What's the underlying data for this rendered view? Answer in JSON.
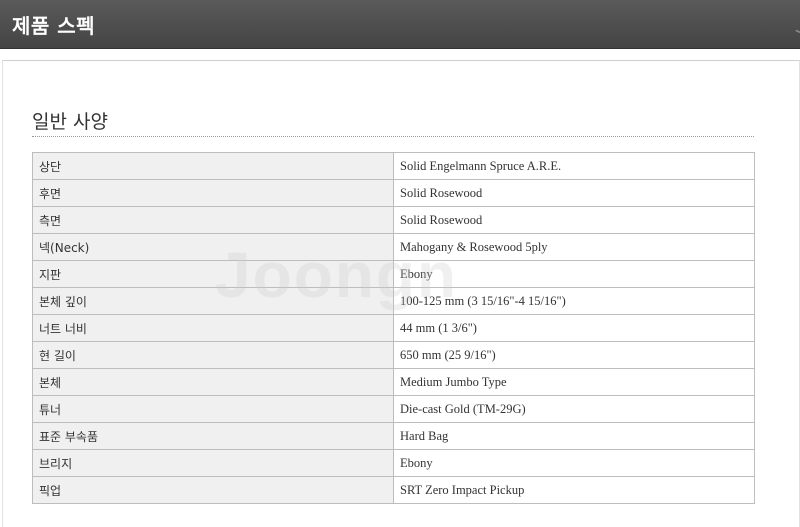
{
  "header": {
    "title": "제품 스펙",
    "corner_watermark": "larr"
  },
  "section": {
    "title": "일반 사양"
  },
  "watermark": "Joongn",
  "specs": [
    {
      "label": "상단",
      "value": "Solid Engelmann Spruce A.R.E."
    },
    {
      "label": "후면",
      "value": "Solid Rosewood"
    },
    {
      "label": "측면",
      "value": "Solid Rosewood"
    },
    {
      "label": "넥(Neck)",
      "value": "Mahogany & Rosewood 5ply"
    },
    {
      "label": "지판",
      "value": "Ebony"
    },
    {
      "label": "본체 깊이",
      "value": "100-125 mm (3 15/16\"-4 15/16\")"
    },
    {
      "label": "너트 너비",
      "value": "44 mm (1 3/6\")"
    },
    {
      "label": "현 길이",
      "value": "650 mm (25 9/16\")"
    },
    {
      "label": "본체",
      "value": "Medium Jumbo Type"
    },
    {
      "label": "튜너",
      "value": "Die-cast Gold (TM-29G)"
    },
    {
      "label": "표준 부속품",
      "value": "Hard Bag"
    },
    {
      "label": "브리지",
      "value": "Ebony"
    },
    {
      "label": "픽업",
      "value": "SRT Zero Impact Pickup"
    }
  ]
}
